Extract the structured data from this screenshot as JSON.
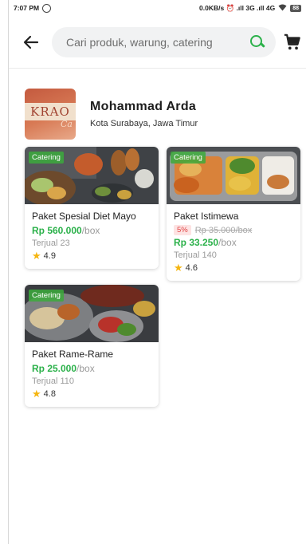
{
  "status_bar": {
    "time": "7:07 PM",
    "network": "0.0KB/s ⏰ .ıll 3G .ıll 4G",
    "battery": "88"
  },
  "search": {
    "placeholder": "Cari produk, warung, catering"
  },
  "merchant": {
    "name": "Mohammad Arda",
    "location": "Kota Surabaya, Jawa Timur",
    "logo_text": "KRAO",
    "logo_sub": "Ca"
  },
  "products": [
    {
      "badge": "Catering",
      "title": "Paket Spesial Diet Mayo",
      "price": "Rp 560.000",
      "unit": "/box",
      "sold": "Terjual 23",
      "rating": "4.9"
    },
    {
      "badge": "Catering",
      "title": "Paket Istimewa",
      "discount_pct": "5%",
      "original_price": "Rp 35.000/box",
      "price": "Rp 33.250",
      "unit": "/box",
      "sold": "Terjual 140",
      "rating": "4.6"
    },
    {
      "badge": "Catering",
      "title": "Paket Rame-Rame",
      "price": "Rp 25.000",
      "unit": "/box",
      "sold": "Terjual 110",
      "rating": "4.8"
    }
  ],
  "colors": {
    "accent": "#2bb14a",
    "rating_star": "#f5b50f",
    "discount": "#e14545"
  }
}
